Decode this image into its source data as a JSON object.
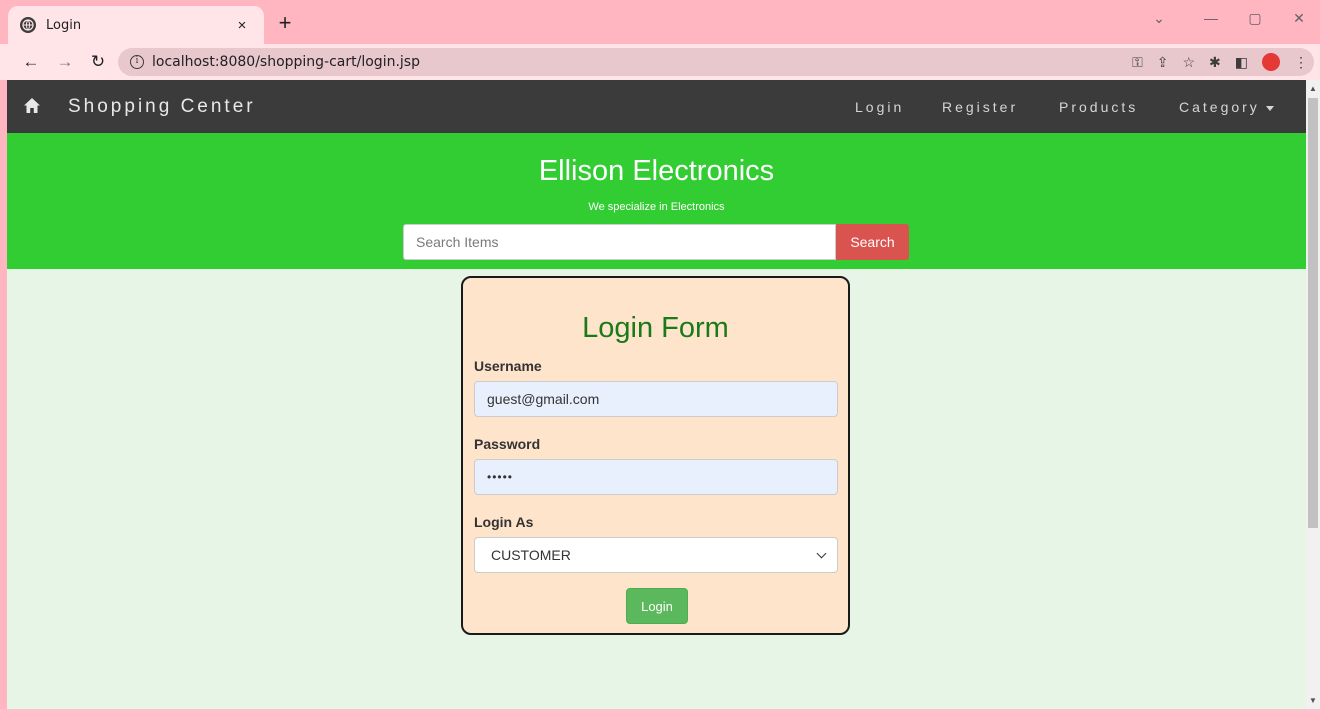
{
  "browser": {
    "tab_title": "Login",
    "tab_close": "×",
    "new_tab": "+",
    "url": "localhost:8080/shopping-cart/login.jsp",
    "window_controls": {
      "dropdown": "⌄",
      "minimize": "—",
      "restore": "▢",
      "close": "✕"
    }
  },
  "navbar": {
    "brand": "Shopping Center",
    "links": [
      "Login",
      "Register",
      "Products",
      "Category"
    ]
  },
  "banner": {
    "title": "Ellison Electronics",
    "subtitle": "We specialize in Electronics",
    "search_placeholder": "Search Items",
    "search_button": "Search"
  },
  "login_form": {
    "title": "Login Form",
    "username_label": "Username",
    "username_value": "guest@gmail.com",
    "password_label": "Password",
    "password_value": "•••••",
    "role_label": "Login As",
    "role_value": "CUSTOMER",
    "submit_label": "Login"
  },
  "colors": {
    "browser_chrome": "#ffb6c1",
    "navbar": "#3b3b3b",
    "banner": "#32cd32",
    "page_background": "#e6f5e6",
    "card_background": "#ffe4cc",
    "search_button": "#d9534f",
    "login_button": "#5cb85c",
    "form_title": "#1a7a1a"
  }
}
